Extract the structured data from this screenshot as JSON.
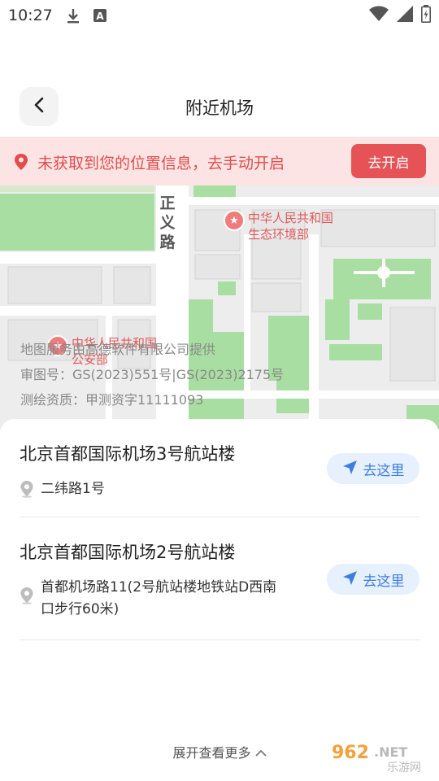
{
  "status_bar": {
    "time": "10:27",
    "icons": [
      "download-icon",
      "a-notification-icon",
      "wifi-icon",
      "signal-icon",
      "battery-icon"
    ]
  },
  "header": {
    "title": "附近机场",
    "back_icon": "chevron-left-icon"
  },
  "location_banner": {
    "message": "未获取到您的位置信息，去手动开启",
    "button_label": "去开启",
    "accent": "#e14c4c"
  },
  "map": {
    "road_label": "正义路",
    "pois": [
      {
        "name_line1": "中华人民共和国",
        "name_line2": "生态环境部"
      },
      {
        "name_line1": "中华人民共和国",
        "name_line2": "公安部"
      }
    ],
    "credits": [
      "地图服务由高德软件有限公司提供",
      "审图号：GS(2023)551号|GS(2023)2175号",
      "测绘资质：甲测资字11111093"
    ]
  },
  "airports": [
    {
      "name": "北京首都国际机场3号航站楼",
      "address": "二纬路1号",
      "go_label": "去这里"
    },
    {
      "name": "北京首都国际机场2号航站楼",
      "address": "首都机场路11(2号航站楼地铁站D西南口步行60米)",
      "go_label": "去这里"
    }
  ],
  "footer": {
    "more_label": "展开查看更多",
    "more_icon": "chevron-up-icon",
    "watermark": "962.NET 乐游网"
  },
  "colors": {
    "accent_blue": "#3d7fe0",
    "button_red": "#e65357",
    "banner_bg": "#fde4e4"
  }
}
